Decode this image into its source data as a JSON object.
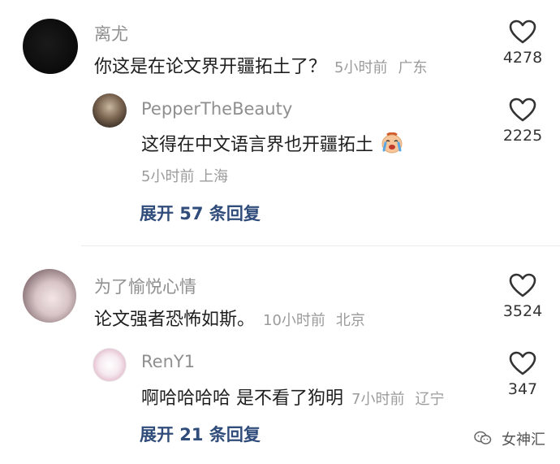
{
  "comments": [
    {
      "username": "离尤",
      "text": "你这是在论文界开疆拓土了？",
      "time": "5小时前",
      "location": "广东",
      "likes": "4278",
      "replies": [
        {
          "username": "PepperTheBeauty",
          "text": "这得在中文语言界也开疆拓土",
          "emoji": "crying-face-emoji",
          "time": "5小时前",
          "location": "上海",
          "likes": "2225"
        }
      ],
      "expand_label": "展开 57 条回复"
    },
    {
      "username": "为了愉悦心情",
      "text": "论文强者恐怖如斯。",
      "time": "10小时前",
      "location": "北京",
      "likes": "3524",
      "replies": [
        {
          "username": "RenY1",
          "text": "啊哈哈哈哈 是不看了狗明",
          "time": "7小时前",
          "location": "辽宁",
          "likes": "347"
        }
      ],
      "expand_label": "展开 21 条回复"
    }
  ],
  "watermark": "女神汇",
  "colors": {
    "username": "#8f8f8f",
    "meta": "#9b9b9b",
    "expand": "#2f4c7a",
    "heart": "#333333"
  }
}
